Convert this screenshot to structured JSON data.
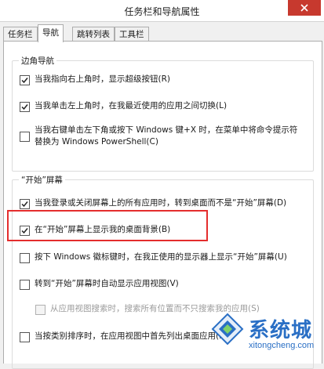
{
  "window": {
    "title": "任务栏和导航属性"
  },
  "tabs": [
    {
      "label": "任务栏"
    },
    {
      "label": "导航"
    },
    {
      "label": "跳转列表"
    },
    {
      "label": "工具栏"
    }
  ],
  "corner_nav": {
    "title": "边角导航",
    "options": [
      {
        "label": "当我指向右上角时，显示超级按钮(R)",
        "checked": true
      },
      {
        "label": "当我单击左上角时，在我最近使用的应用之间切换(L)",
        "checked": true
      },
      {
        "label_line1": "当我右键单击左下角或按下 Windows 键+X 时，在菜单中将命令提示符",
        "label_line2": "替换为 Windows PowerShell(C)",
        "checked": false
      }
    ]
  },
  "start_screen": {
    "title": "“开始”屏幕",
    "options": [
      {
        "label": "当我登录或关闭屏幕上的所有应用时，转到桌面而不是“开始”屏幕(D)",
        "checked": true
      },
      {
        "label": "在“开始”屏幕上显示我的桌面背景(B)",
        "checked": true
      },
      {
        "label": "按下 Windows 徽标键时，在我正使用的显示器上显示“开始”屏幕(U)",
        "checked": false
      },
      {
        "label": "转到“开始”屏幕时自动显示应用视图(V)",
        "checked": false
      },
      {
        "label": "从应用视图搜索时，搜索所有位置而不只搜索我的应用(S)",
        "checked": false,
        "disabled": true
      },
      {
        "label": "当按类别排序时，在应用视图中首先列出桌面应用(H)",
        "checked": false
      }
    ]
  },
  "watermark": {
    "name": "系统城",
    "url": "xitongcheng.com"
  },
  "colors": {
    "highlight": "#e42d2d",
    "close": "#c7392e",
    "watermark": "#2a6fc5"
  }
}
